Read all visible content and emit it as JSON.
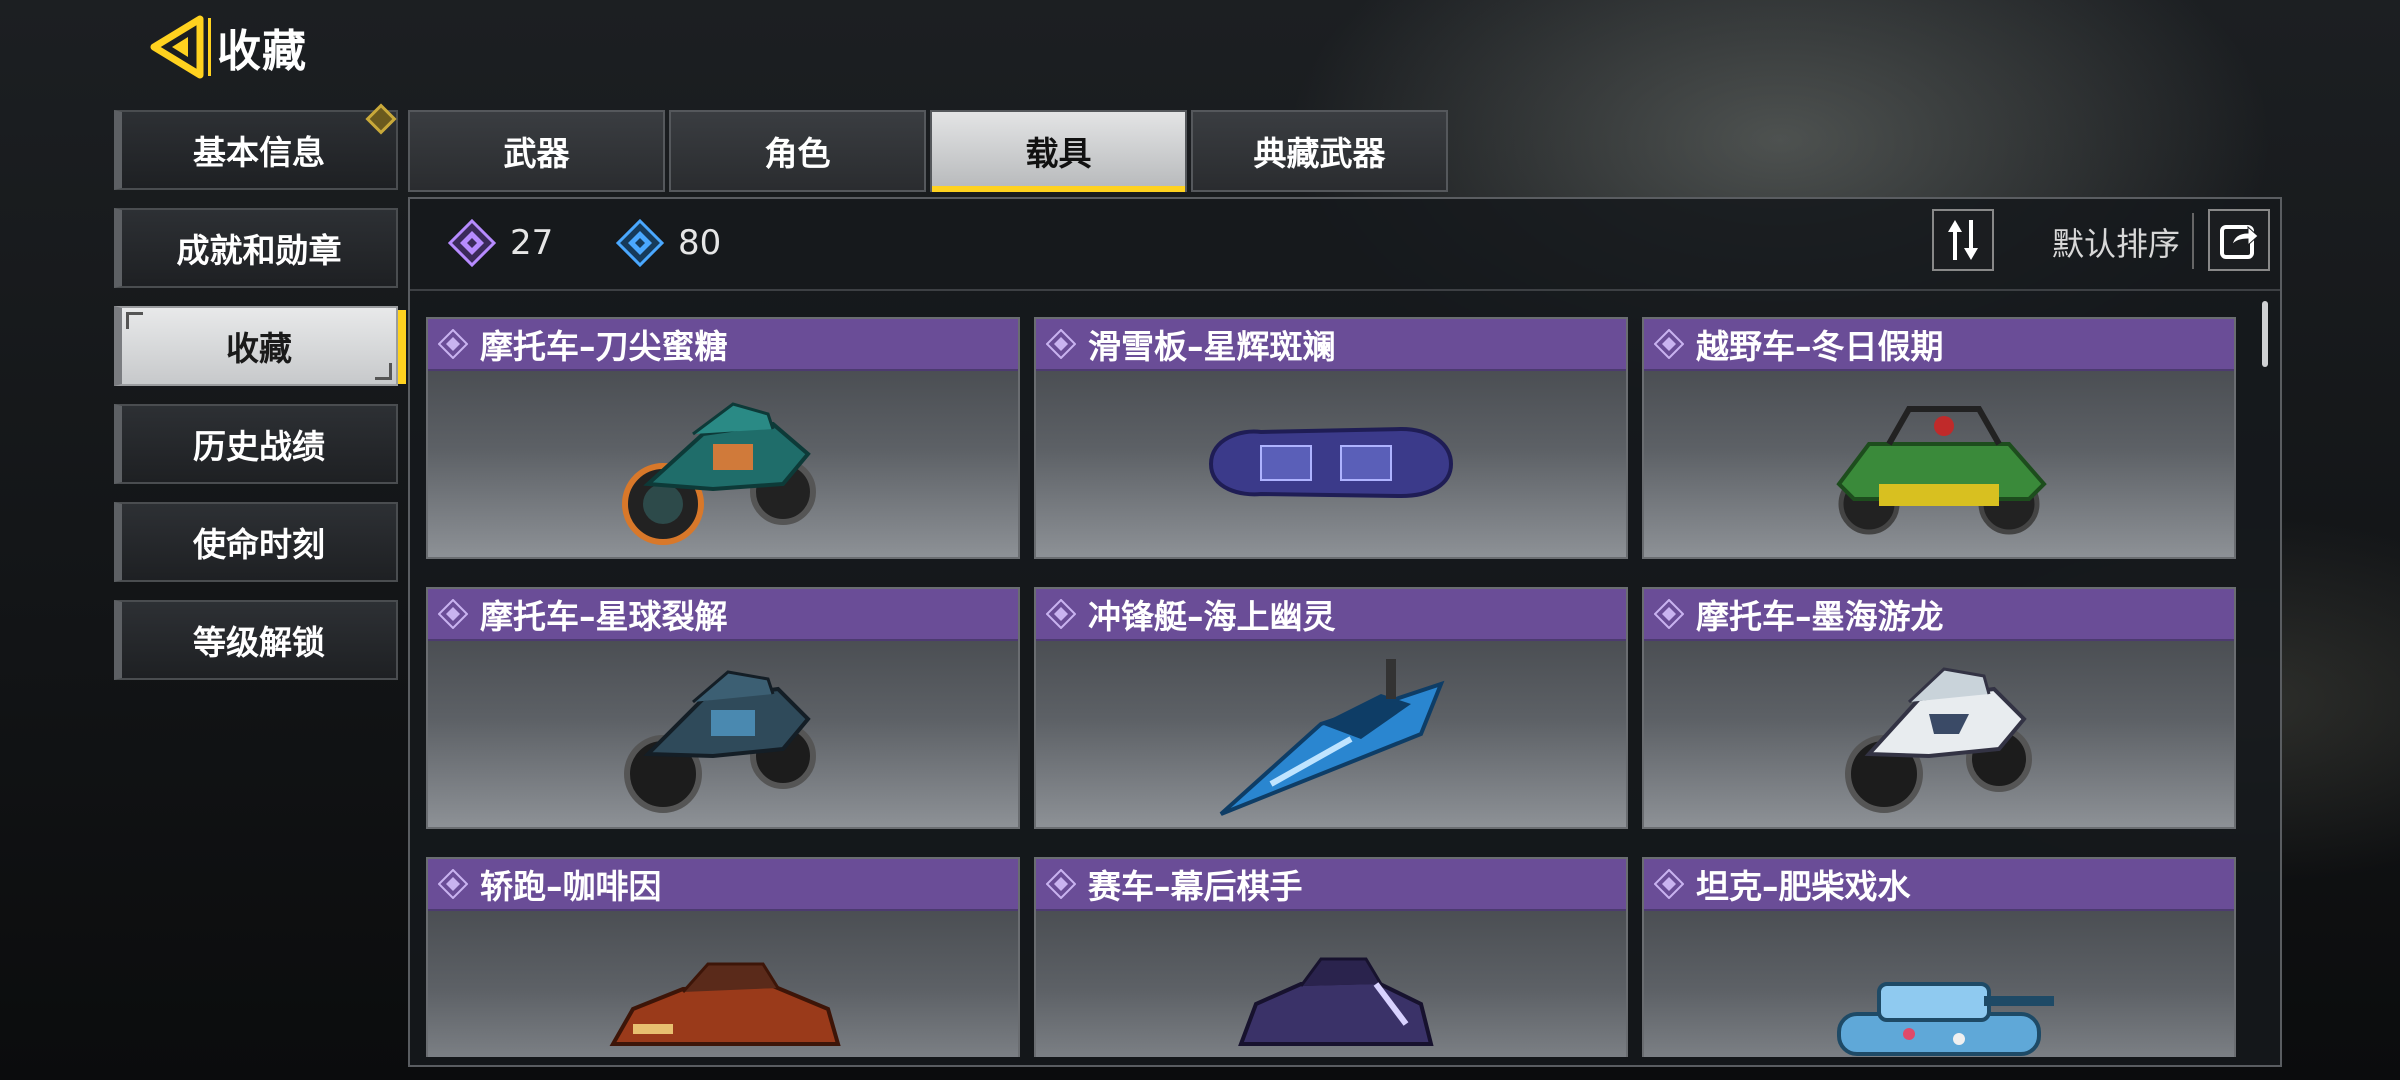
{
  "header": {
    "title": "收藏"
  },
  "nav": [
    {
      "label": "基本信息",
      "active": false,
      "badge": true
    },
    {
      "label": "成就和勋章",
      "active": false
    },
    {
      "label": "收藏",
      "active": true
    },
    {
      "label": "历史战绩",
      "active": false
    },
    {
      "label": "使命时刻",
      "active": false
    },
    {
      "label": "等级解锁",
      "active": false
    }
  ],
  "tabs": [
    {
      "label": "武器",
      "active": false
    },
    {
      "label": "角色",
      "active": false
    },
    {
      "label": "载具",
      "active": true
    },
    {
      "label": "典藏武器",
      "active": false
    }
  ],
  "stats": {
    "purple_count": "27",
    "blue_count": "80"
  },
  "sort": {
    "label": "默认排序"
  },
  "items": [
    {
      "name": "摩托车–刀尖蜜糖",
      "icon": "motorcycle-teal"
    },
    {
      "name": "滑雪板–星辉斑斓",
      "icon": "snowboard-blue"
    },
    {
      "name": "越野车–冬日假期",
      "icon": "buggy-green"
    },
    {
      "name": "摩托车–星球裂解",
      "icon": "motorcycle-dark"
    },
    {
      "name": "冲锋艇–海上幽灵",
      "icon": "speedboat-blue"
    },
    {
      "name": "摩托车–墨海游龙",
      "icon": "motorcycle-white"
    },
    {
      "name": "轿跑–咖啡因",
      "icon": "coupe-red"
    },
    {
      "name": "赛车–幕后棋手",
      "icon": "racecar-purple"
    },
    {
      "name": "坦克–肥柴戏水",
      "icon": "tank-blue"
    }
  ],
  "colors": {
    "accent": "#ffd21f",
    "card_header": "#6a4d97",
    "purple_gem": "#b78bff",
    "blue_gem": "#4aa8ff"
  }
}
